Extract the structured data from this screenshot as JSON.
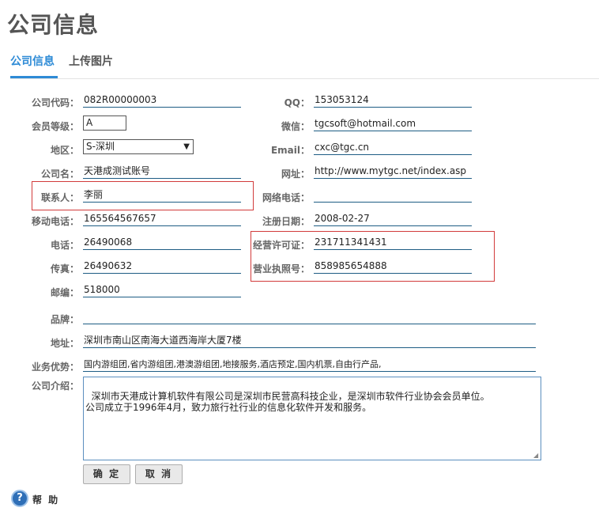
{
  "page_title": "公司信息",
  "tabs": [
    {
      "label": "公司信息",
      "active": true
    },
    {
      "label": "上传图片",
      "active": false
    }
  ],
  "form": {
    "company_code": {
      "label": "公司代码：",
      "value": "082R00000003"
    },
    "qq": {
      "label": "QQ：",
      "value": "153053124"
    },
    "member_level": {
      "label": "会员等级：",
      "value": "A"
    },
    "wechat": {
      "label": "微信：",
      "value": "tgcsoft@hotmail.com"
    },
    "region": {
      "label": "地区：",
      "value": "S-深圳"
    },
    "email": {
      "label": "Email：",
      "value": "cxc@tgc.cn"
    },
    "company_name": {
      "label": "公司名：",
      "value": "天港成测试账号"
    },
    "website": {
      "label": "网址：",
      "value": "http://www.mytgc.net/index.asp"
    },
    "contact": {
      "label": "联系人：",
      "value": "李丽"
    },
    "online_phone": {
      "label": "网络电话：",
      "value": ""
    },
    "mobile": {
      "label": "移动电话：",
      "value": "165564567657"
    },
    "reg_date": {
      "label": "注册日期：",
      "value": "2008-02-27"
    },
    "phone": {
      "label": "电话：",
      "value": "26490068"
    },
    "business_license": {
      "label": "经营许可证：",
      "value": "231711341431"
    },
    "fax": {
      "label": "传真：",
      "value": "26490632"
    },
    "business_permit": {
      "label": "营业执照号：",
      "value": "858985654888"
    },
    "postcode": {
      "label": "邮编：",
      "value": "518000"
    },
    "brand": {
      "label": "品牌：",
      "value": ""
    },
    "address": {
      "label": "地址：",
      "value": "深圳市南山区南海大道西海岸大厦7楼"
    },
    "advantages": {
      "label": "业务优势：",
      "value": "国内游组团,省内游组团,港澳游组团,地接服务,酒店预定,国内机票,自由行产品,"
    },
    "intro": {
      "label": "公司介绍：",
      "value": "深圳市天港成计算机软件有限公司是深圳市民营高科技企业，是深圳市软件行业协会会员单位。\n公司成立于1996年4月，致力旅行社行业的信息化软件开发和服务。"
    }
  },
  "buttons": {
    "confirm": "确 定",
    "cancel": "取 消"
  },
  "help": {
    "label": "帮 助"
  }
}
